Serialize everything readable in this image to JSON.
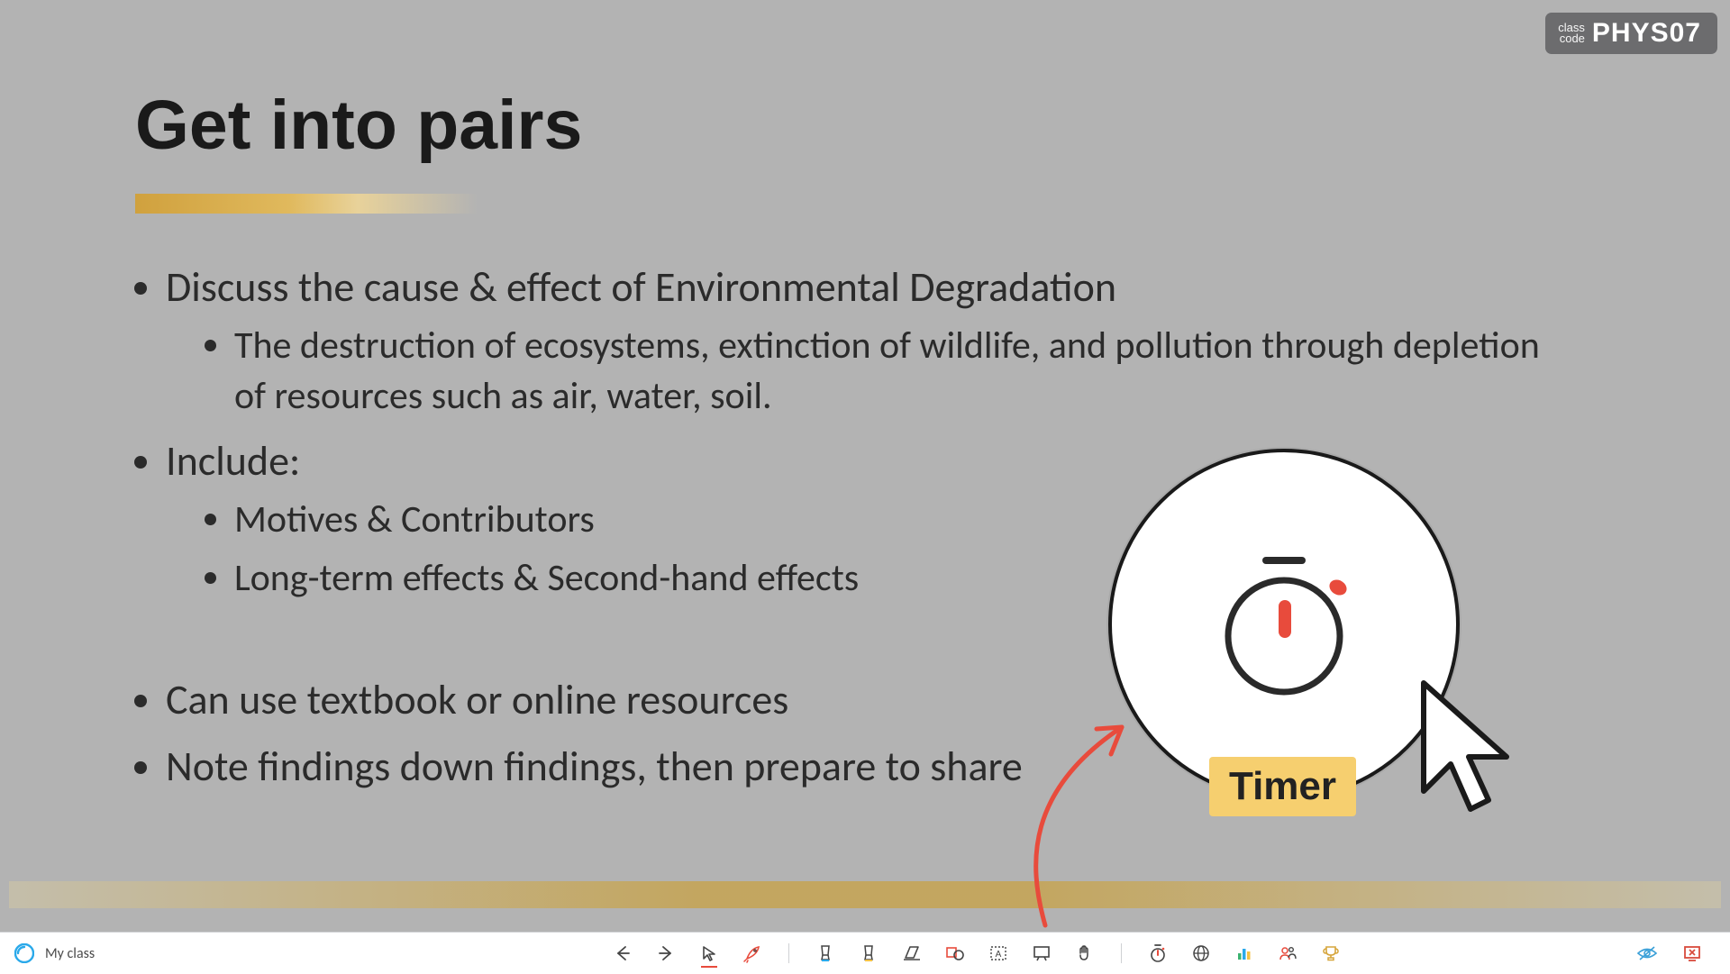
{
  "class_code": {
    "label_line1": "class",
    "label_line2": "code",
    "code": "PHYS07"
  },
  "slide": {
    "title": "Get into pairs",
    "bullet1": "Discuss the cause & effect of Environmental Degradation",
    "bullet1_sub1": "The destruction of ecosystems, extinction of wildlife, and pollution through depletion of resources such as air, water, soil.",
    "bullet2": "Include:",
    "bullet2_sub1": "Motives & Contributors",
    "bullet2_sub2": "Long-term effects & Second-hand effects",
    "bullet3": "Can use textbook or online resources",
    "bullet4": "Note findings down findings, then prepare to share"
  },
  "annotation": {
    "spotlight_label": "Timer"
  },
  "toolbar": {
    "class_name": "My class",
    "tools": {
      "prev": "Previous",
      "next": "Next",
      "pointer": "Pointer",
      "rocket": "Magic ink",
      "highlighter_blue": "Highlighter",
      "highlighter_yellow": "Highlighter",
      "eraser": "Eraser",
      "shape": "Shapes",
      "textbox": "Text box",
      "whiteboard": "Whiteboard",
      "hand": "Pan",
      "timer": "Timer",
      "browser": "Web browser",
      "poll": "Poll",
      "participants": "Participants",
      "trophy": "Awards",
      "visibility": "Hide toolbar",
      "exit": "Exit"
    }
  },
  "colors": {
    "accent_gold": "#d0a13e",
    "accent_red": "#e84b3c",
    "label_bg": "#f6cf6f"
  }
}
